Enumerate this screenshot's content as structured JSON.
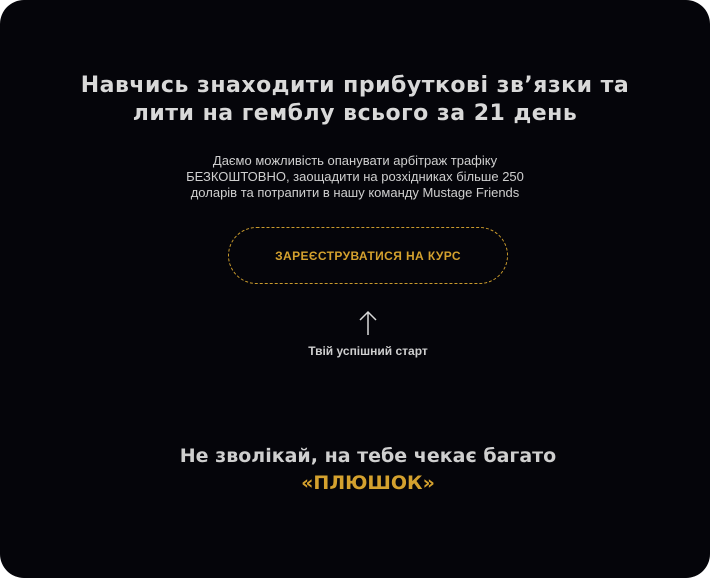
{
  "hero": {
    "headline_line1": "Навчись знаходити прибуткові зв’язки та",
    "headline_line2": "лити на гемблу всього за 21 день",
    "description_line1": "Даємо можливість опанувати арбітраж трафіку",
    "description_line2": "БЕЗКОШТОВНО, заощадити на розхідниках більше 250",
    "description_line3": "доларів та потрапити в нашу команду Mustage Friends"
  },
  "cta": {
    "label": "ЗАРЕЄСТРУВАТИСЯ НА КУРС"
  },
  "start": {
    "label": "Твій успішний старт"
  },
  "footer": {
    "line1": "Не зволікай, на тебе чекає багато",
    "line2": "«ПЛЮШОК»"
  },
  "colors": {
    "background": "#05050a",
    "accent": "#d4a12e",
    "text": "#d9d9d9"
  },
  "icons": {
    "arrow": "arrow-up-icon"
  }
}
